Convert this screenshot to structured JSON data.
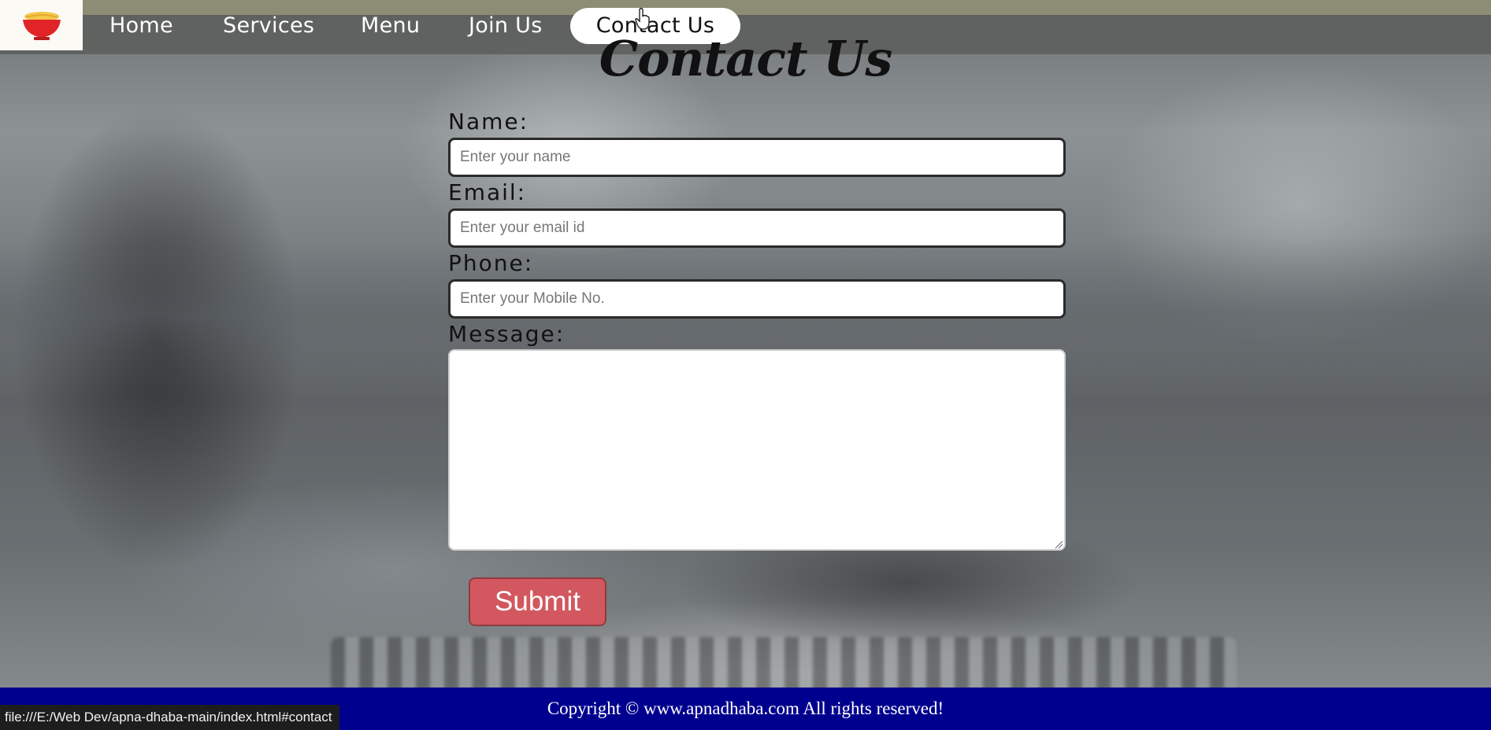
{
  "nav": {
    "logo_icon": "noodle-bowl-icon",
    "links": [
      {
        "label": "Home"
      },
      {
        "label": "Services"
      },
      {
        "label": "Menu"
      },
      {
        "label": "Join Us"
      }
    ],
    "active": {
      "label": "Contact Us"
    }
  },
  "main": {
    "title": "Contact Us",
    "form": {
      "name": {
        "label": "Name:",
        "placeholder": "Enter your name",
        "value": ""
      },
      "email": {
        "label": "Email:",
        "placeholder": "Enter your email id",
        "value": ""
      },
      "phone": {
        "label": "Phone:",
        "placeholder": "Enter your Mobile No.",
        "value": ""
      },
      "message": {
        "label": "Message:",
        "value": ""
      },
      "submit_label": "Submit"
    }
  },
  "footer": {
    "copyright": "Copyright © www.apnadhaba.com All rights reserved!"
  },
  "status_bar": {
    "url": "file:///E:/Web Dev/apna-dhaba-main/index.html#contact"
  },
  "colors": {
    "footer_bg": "#00008f",
    "submit_bg": "#d2575f",
    "nav_bg": "#5c5e5c",
    "top_strip": "#8d8c74"
  },
  "cursor_icon": "pointer-hand-icon"
}
